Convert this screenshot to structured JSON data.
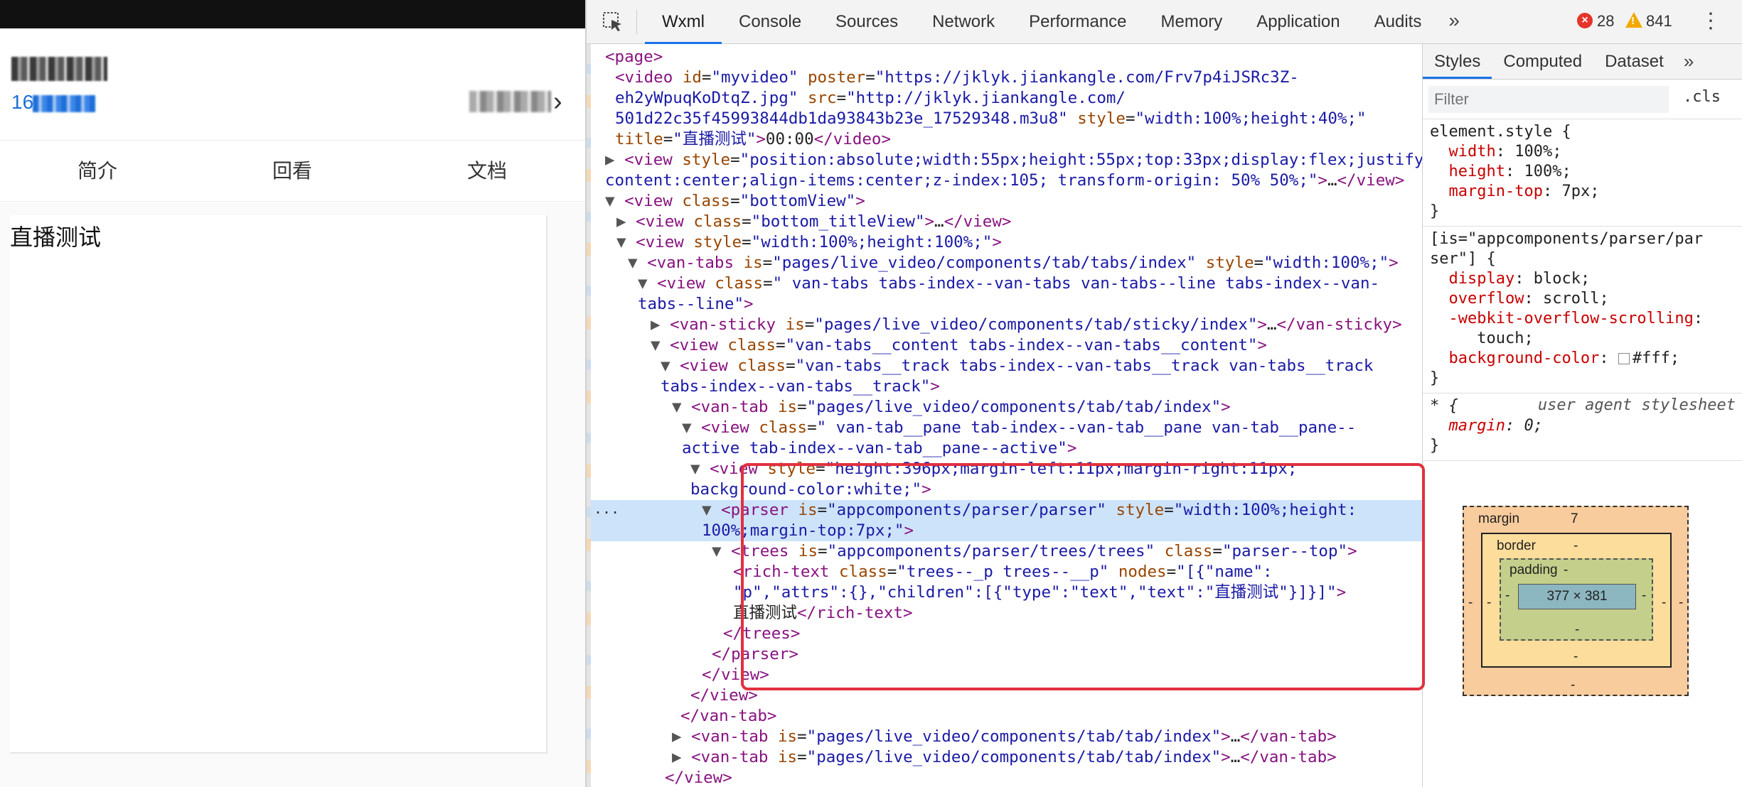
{
  "simulator": {
    "sub_prefix": "16",
    "tabs": [
      "简介",
      "回看",
      "文档"
    ],
    "content_text": "直播测试"
  },
  "devtools": {
    "panel_tabs": [
      "Wxml",
      "Console",
      "Sources",
      "Network",
      "Performance",
      "Memory",
      "Application",
      "Audits"
    ],
    "more": "»",
    "error_count": "28",
    "warning_count": "841",
    "tree_lines": [
      [
        [
          "t",
          "<page>"
        ]
      ],
      [
        [
          "t",
          "<video "
        ],
        [
          "a",
          "id"
        ],
        [
          "x",
          "="
        ],
        [
          "v",
          "\"myvideo\""
        ],
        [
          "x",
          " "
        ],
        [
          "a",
          "poster"
        ],
        [
          "x",
          "="
        ],
        [
          "v",
          "\"https://jklyk.jiankangle.com/Frv7p4iJSRc3Z-"
        ]
      ],
      [
        [
          "v",
          "eh2yWpuqKoDtqZ.jpg\""
        ],
        [
          "x",
          " "
        ],
        [
          "a",
          "src"
        ],
        [
          "x",
          "="
        ],
        [
          "v",
          "\"http://jklyk.jiankangle.com/"
        ]
      ],
      [
        [
          "v",
          "501d22c35f45993844db1da93843b23e_17529348.m3u8\""
        ],
        [
          "x",
          " "
        ],
        [
          "a",
          "style"
        ],
        [
          "x",
          "="
        ],
        [
          "v",
          "\"width:100%;height:40%;\""
        ]
      ],
      [
        [
          "a",
          "title"
        ],
        [
          "x",
          "="
        ],
        [
          "v",
          "\"直播测试\""
        ],
        [
          "t",
          ">"
        ],
        [
          "x",
          "00:00"
        ],
        [
          "t",
          "</video>"
        ]
      ],
      [
        [
          "r",
          "▶"
        ],
        [
          "t",
          "<view "
        ],
        [
          "a",
          "style"
        ],
        [
          "x",
          "="
        ],
        [
          "v",
          "\"position:absolute;width:55px;height:55px;top:33px;display:flex;justify-"
        ]
      ],
      [
        [
          "v",
          "content:center;align-items:center;z-index:105; transform-origin: 50% 50%;\""
        ],
        [
          "t",
          ">"
        ],
        [
          "x",
          "…"
        ],
        [
          "t",
          "</view>"
        ]
      ],
      [
        [
          "r",
          "▼"
        ],
        [
          "t",
          "<view "
        ],
        [
          "a",
          "class"
        ],
        [
          "x",
          "="
        ],
        [
          "v",
          "\"bottomView\""
        ],
        [
          "t",
          ">"
        ]
      ],
      [
        [
          "r",
          "▶"
        ],
        [
          "t",
          "<view "
        ],
        [
          "a",
          "class"
        ],
        [
          "x",
          "="
        ],
        [
          "v",
          "\"bottom_titleView\""
        ],
        [
          "t",
          ">"
        ],
        [
          "x",
          "…"
        ],
        [
          "t",
          "</view>"
        ]
      ],
      [
        [
          "r",
          "▼"
        ],
        [
          "t",
          "<view "
        ],
        [
          "a",
          "style"
        ],
        [
          "x",
          "="
        ],
        [
          "v",
          "\"width:100%;height:100%;\""
        ],
        [
          "t",
          ">"
        ]
      ],
      [
        [
          "r",
          "▼"
        ],
        [
          "t",
          "<van-tabs "
        ],
        [
          "a",
          "is"
        ],
        [
          "x",
          "="
        ],
        [
          "v",
          "\"pages/live_video/components/tab/tabs/index\""
        ],
        [
          "x",
          " "
        ],
        [
          "a",
          "style"
        ],
        [
          "x",
          "="
        ],
        [
          "v",
          "\"width:100%;\""
        ],
        [
          "t",
          ">"
        ]
      ],
      [
        [
          "r",
          "▼"
        ],
        [
          "t",
          "<view "
        ],
        [
          "a",
          "class"
        ],
        [
          "x",
          "="
        ],
        [
          "v",
          "\" van-tabs tabs-index--van-tabs van-tabs--line tabs-index--van-"
        ]
      ],
      [
        [
          "v",
          "tabs--line\""
        ],
        [
          "t",
          ">"
        ]
      ],
      [
        [
          "r",
          "▶"
        ],
        [
          "t",
          "<van-sticky "
        ],
        [
          "a",
          "is"
        ],
        [
          "x",
          "="
        ],
        [
          "v",
          "\"pages/live_video/components/tab/sticky/index\""
        ],
        [
          "t",
          ">"
        ],
        [
          "x",
          "…"
        ],
        [
          "t",
          "</van-sticky>"
        ]
      ],
      [
        [
          "r",
          "▼"
        ],
        [
          "t",
          "<view "
        ],
        [
          "a",
          "class"
        ],
        [
          "x",
          "="
        ],
        [
          "v",
          "\"van-tabs__content tabs-index--van-tabs__content\""
        ],
        [
          "t",
          ">"
        ]
      ],
      [
        [
          "r",
          "▼"
        ],
        [
          "t",
          "<view "
        ],
        [
          "a",
          "class"
        ],
        [
          "x",
          "="
        ],
        [
          "v",
          "\"van-tabs__track tabs-index--van-tabs__track van-tabs__track"
        ]
      ],
      [
        [
          "v",
          "tabs-index--van-tabs__track\""
        ],
        [
          "t",
          ">"
        ]
      ],
      [
        [
          "r",
          "▼"
        ],
        [
          "t",
          "<van-tab "
        ],
        [
          "a",
          "is"
        ],
        [
          "x",
          "="
        ],
        [
          "v",
          "\"pages/live_video/components/tab/tab/index\""
        ],
        [
          "t",
          ">"
        ]
      ],
      [
        [
          "r",
          "▼"
        ],
        [
          "t",
          "<view "
        ],
        [
          "a",
          "class"
        ],
        [
          "x",
          "="
        ],
        [
          "v",
          "\" van-tab__pane tab-index--van-tab__pane van-tab__pane--"
        ]
      ],
      [
        [
          "v",
          "active tab-index--van-tab__pane--active\""
        ],
        [
          "t",
          ">"
        ]
      ],
      [
        [
          "r",
          "▼"
        ],
        [
          "t",
          "<view "
        ],
        [
          "a",
          "style"
        ],
        [
          "x",
          "="
        ],
        [
          "v",
          "\"height:396px;margin-left:11px;margin-right:11px;"
        ]
      ],
      [
        [
          "v",
          "background-color:white;\""
        ],
        [
          "t",
          ">"
        ]
      ],
      [
        [
          "r",
          "▼"
        ],
        [
          "t",
          "<parser "
        ],
        [
          "a",
          "is"
        ],
        [
          "x",
          "="
        ],
        [
          "v",
          "\"appcomponents/parser/parser\""
        ],
        [
          "x",
          " "
        ],
        [
          "a",
          "style"
        ],
        [
          "x",
          "="
        ],
        [
          "v",
          "\"width:100%;height:"
        ]
      ],
      [
        [
          "v",
          "100%;margin-top:7px;\""
        ],
        [
          "t",
          ">"
        ]
      ],
      [
        [
          "r",
          "▼"
        ],
        [
          "t",
          "<trees "
        ],
        [
          "a",
          "is"
        ],
        [
          "x",
          "="
        ],
        [
          "v",
          "\"appcomponents/parser/trees/trees\""
        ],
        [
          "x",
          " "
        ],
        [
          "a",
          "class"
        ],
        [
          "x",
          "="
        ],
        [
          "v",
          "\"parser--top\""
        ],
        [
          "t",
          ">"
        ]
      ],
      [
        [
          "t",
          "<rich-text "
        ],
        [
          "a",
          "class"
        ],
        [
          "x",
          "="
        ],
        [
          "v",
          "\"trees--_p trees--__p\""
        ],
        [
          "x",
          " "
        ],
        [
          "a",
          "nodes"
        ],
        [
          "x",
          "="
        ],
        [
          "v",
          "\"[{\"name\":"
        ]
      ],
      [
        [
          "v",
          "\"p\",\"attrs\":{},\"children\":[{\"type\":\"text\",\"text\":\"直播测试\"}]}]\""
        ],
        [
          "t",
          ">"
        ]
      ],
      [
        [
          "x",
          "直播测试"
        ],
        [
          "t",
          "</rich-text>"
        ]
      ],
      [
        [
          "t",
          "</trees>"
        ]
      ],
      [
        [
          "t",
          "</parser>"
        ]
      ],
      [
        [
          "t",
          "</view>"
        ]
      ],
      [
        [
          "t",
          "</view>"
        ]
      ],
      [
        [
          "t",
          "</van-tab>"
        ]
      ],
      [
        [
          "r",
          "▶"
        ],
        [
          "t",
          "<van-tab "
        ],
        [
          "a",
          "is"
        ],
        [
          "x",
          "="
        ],
        [
          "v",
          "\"pages/live_video/components/tab/tab/index\""
        ],
        [
          "t",
          ">"
        ],
        [
          "x",
          "…"
        ],
        [
          "t",
          "</van-tab>"
        ]
      ],
      [
        [
          "r",
          "▶"
        ],
        [
          "t",
          "<van-tab "
        ],
        [
          "a",
          "is"
        ],
        [
          "x",
          "="
        ],
        [
          "v",
          "\"pages/live_video/components/tab/tab/index\""
        ],
        [
          "t",
          ">"
        ],
        [
          "x",
          "…"
        ],
        [
          "t",
          "</van-tab>"
        ]
      ],
      [
        [
          "t",
          "</view>"
        ]
      ]
    ],
    "selected_line_ellipsis": "..."
  },
  "styles": {
    "tabs": [
      "Styles",
      "Computed",
      "Dataset"
    ],
    "more": "»",
    "filter_placeholder": "Filter",
    "cls": ".cls",
    "element_style_selector": "element.style {",
    "element_style_props": [
      {
        "name": "width",
        "value": "100%;"
      },
      {
        "name": "height",
        "value": "100%;"
      },
      {
        "name": "margin-top",
        "value": "7px;"
      }
    ],
    "parser_selector_line1": "[is=\"appcomponents/parser/par",
    "parser_selector_line2": "ser\"] {",
    "parser_props": [
      {
        "name": "display",
        "value": "block;"
      },
      {
        "name": "overflow",
        "value": "scroll;"
      },
      {
        "name": "-webkit-overflow-scrolling",
        "value": ""
      },
      {
        "name": "",
        "value": "touch;"
      },
      {
        "name": "background-color",
        "value": "#fff;"
      }
    ],
    "ua_selector": "* {",
    "ua_label": "user agent stylesheet",
    "ua_props": [
      {
        "name": "margin",
        "value": "0;"
      }
    ],
    "close_brace": "}"
  },
  "box_model": {
    "margin_label": "margin",
    "margin_top": "7",
    "border_label": "border",
    "padding_label": "padding",
    "dash": "-",
    "content_size": "377 × 381"
  },
  "colors": {
    "accent_blue": "#1a73e8",
    "selection": "#cde3fa",
    "highlight_red": "#e2303f",
    "error": "#e5342b",
    "warning": "#f2a900"
  }
}
